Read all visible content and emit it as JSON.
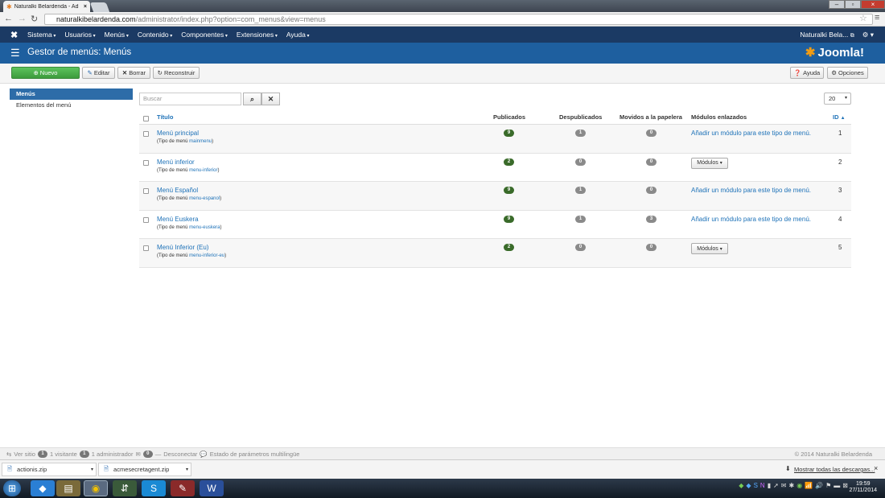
{
  "browser": {
    "tab_title": "Naturalki Belardenda - Ad",
    "url_host": "naturalkibelardenda.com",
    "url_path": "/administrator/index.php?option=com_menus&view=menus"
  },
  "topnav": {
    "menu": [
      "Sistema",
      "Usuarios",
      "Menús",
      "Contenido",
      "Componentes",
      "Extensiones",
      "Ayuda"
    ],
    "site_name": "Naturalki Bela..."
  },
  "header": {
    "title": "Gestor de menús: Menús",
    "logo": "Joomla!"
  },
  "toolbar": {
    "new": "Nuevo",
    "edit": "Editar",
    "delete": "Borrar",
    "rebuild": "Reconstruir",
    "help": "Ayuda",
    "options": "Opciones"
  },
  "sidebar": {
    "items": [
      {
        "label": "Menús"
      },
      {
        "label": "Elementos del menú"
      }
    ]
  },
  "filter": {
    "search_placeholder": "Buscar",
    "limit": "20"
  },
  "table": {
    "headers": {
      "title": "Título",
      "published": "Publicados",
      "unpublished": "Despublicados",
      "trashed": "Movidos a la papelera",
      "modules": "Módulos enlazados",
      "id": "ID"
    },
    "type_prefix": "(Tipo de menú",
    "rows": [
      {
        "title": "Menú principal",
        "type": "mainmenu",
        "published": "9",
        "unpublished": "1",
        "trashed": "0",
        "module": "Añadir un módulo para este tipo de menú.",
        "id": "1"
      },
      {
        "title": "Menú inferior",
        "type": "menu-inferior",
        "published": "2",
        "unpublished": "0",
        "trashed": "0",
        "module": "Módulos",
        "id": "2"
      },
      {
        "title": "Menú Español",
        "type": "menu-espanol",
        "published": "9",
        "unpublished": "1",
        "trashed": "0",
        "module": "Añadir un módulo para este tipo de menú.",
        "id": "3"
      },
      {
        "title": "Menú Euskera",
        "type": "menu-euskera",
        "published": "9",
        "unpublished": "1",
        "trashed": "3",
        "module": "Añadir un módulo para este tipo de menú.",
        "id": "4"
      },
      {
        "title": "Menú Inferior (Eu)",
        "type": "menu-inferior-eu",
        "published": "2",
        "unpublished": "0",
        "trashed": "0",
        "module": "Módulos",
        "id": "5"
      }
    ]
  },
  "statusbar": {
    "view_site": "Ver sitio",
    "visitors_count": "1",
    "visitors": "1 visitante",
    "admins_count": "1",
    "admins": "1 administrador",
    "messages_count": "0",
    "logout": "Desconectar",
    "multilang": "Estado de parámetros multilingüe",
    "copyright": "© 2014 Naturalki Belardenda"
  },
  "downloads": {
    "files": [
      "actionis.zip",
      "acmesecretagent.zip"
    ],
    "show_all": "Mostrar todas las descargas..."
  },
  "taskbar": {
    "time": "19:59",
    "date": "27/11/2014"
  }
}
